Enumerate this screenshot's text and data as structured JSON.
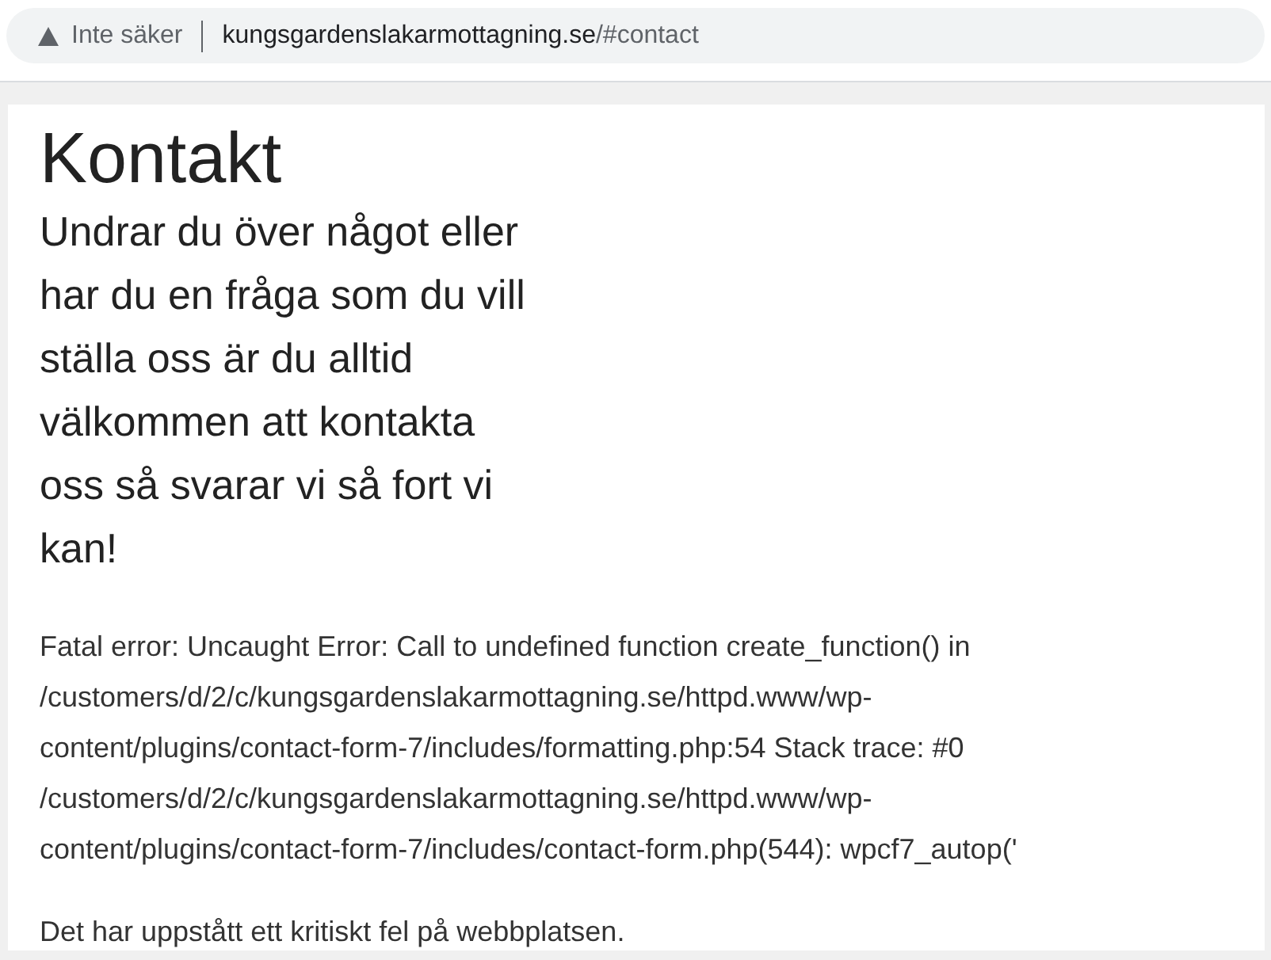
{
  "address_bar": {
    "security_label": "Inte säker",
    "url_host": "kungsgardenslakarmottagning.se",
    "url_path": "/#contact"
  },
  "page": {
    "heading": "Kontakt",
    "intro_lines": [
      "Undrar du över något eller",
      "har du en fråga som du vill",
      "ställa oss är du alltid",
      "välkommen att kontakta",
      "oss så svarar vi så fort vi",
      "kan!"
    ],
    "error_lines": [
      "Fatal error: Uncaught Error: Call to undefined function create_function() in",
      "/customers/d/2/c/kungsgardenslakarmottagning.se/httpd.www/wp-",
      "content/plugins/contact-form-7/includes/formatting.php:54 Stack trace: #0",
      "/customers/d/2/c/kungsgardenslakarmottagning.se/httpd.www/wp-",
      "content/plugins/contact-form-7/includes/contact-form.php(544): wpcf7_autop('"
    ],
    "critical_message": "Det har uppstått ett kritiskt fel på webbplatsen."
  }
}
